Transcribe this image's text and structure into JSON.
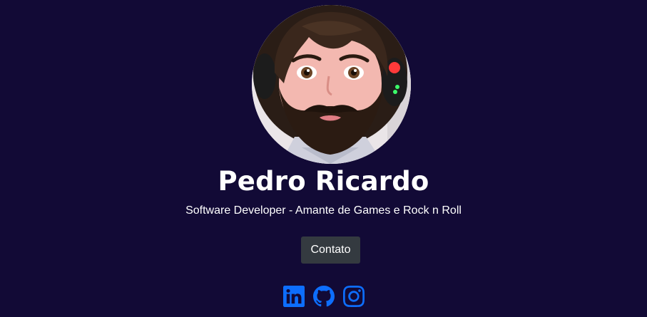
{
  "profile": {
    "name": "Pedro Ricardo",
    "subtitle": "Software Developer - Amante de Games e Rock n Roll",
    "contact_label": "Contato"
  },
  "social": [
    {
      "icon": "linkedin-icon",
      "name": "LinkedIn"
    },
    {
      "icon": "github-icon",
      "name": "GitHub"
    },
    {
      "icon": "instagram-icon",
      "name": "Instagram"
    }
  ],
  "colors": {
    "background": "#120a36",
    "button": "#343a40",
    "icon_accent": "#0d6efd",
    "text": "#ffffff"
  }
}
